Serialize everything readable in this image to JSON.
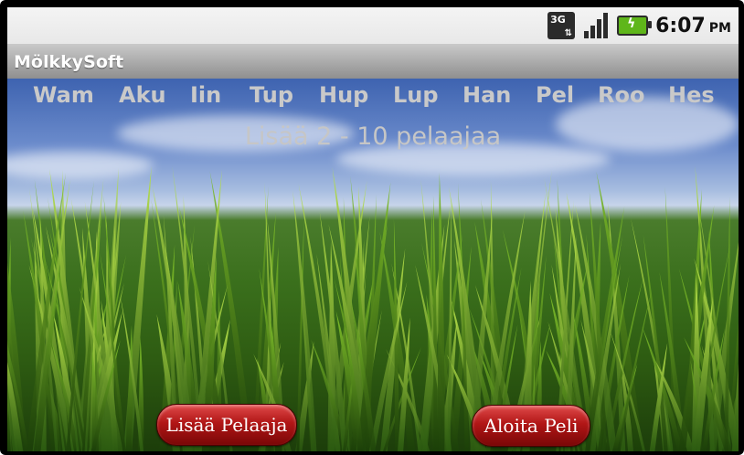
{
  "status_bar": {
    "network_icon": "3g-network-icon",
    "network_label": "3G",
    "signal_icon": "signal-strength-icon",
    "battery_icon": "battery-charging-icon",
    "time": "6:07",
    "ampm": "PM"
  },
  "app": {
    "title": "MölkkySoft"
  },
  "players": [
    "Wam",
    "Aku",
    "Iin",
    "Tup",
    "Hup",
    "Lup",
    "Han",
    "Pel",
    "Roo",
    "Hes"
  ],
  "hint": "Lisää 2 - 10 pelaajaa",
  "buttons": {
    "add_player": "Lisää Pelaaja",
    "start_game": "Aloita Peli"
  },
  "colors": {
    "button_red": "#b11616",
    "player_text": "#c9c9c9"
  }
}
